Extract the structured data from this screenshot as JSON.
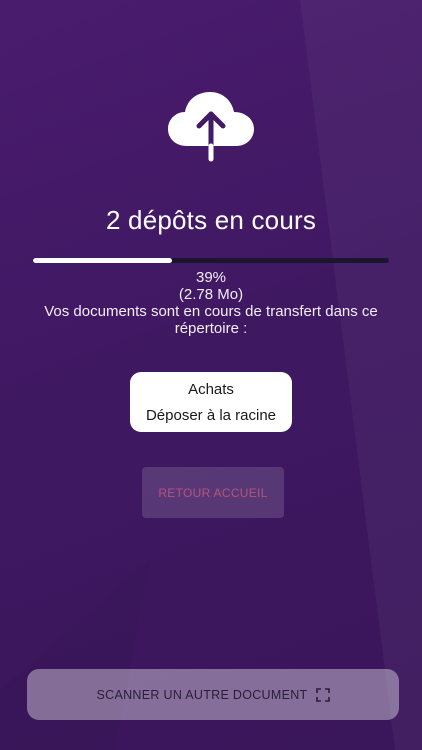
{
  "upload": {
    "title": "2 dépôts en cours",
    "progress_percent": 39,
    "progress_text": "39%",
    "size_text": "(2.78 Mo)",
    "message": "Vos documents sont en cours de transfert dans ce répertoire :"
  },
  "folder": {
    "name": "Achats",
    "action": "Déposer à la racine"
  },
  "buttons": {
    "home_label": "RETOUR ACCUEIL",
    "scan_label": "SCANNER UN AUTRE DOCUMENT"
  },
  "icons": {
    "upload": "cloud-upload-icon",
    "scan": "scan-frame-icon"
  },
  "colors": {
    "background": "#421a66",
    "progress_fill": "#ffffff",
    "progress_track": "#1c1530",
    "home_button_text": "#b2557e"
  }
}
